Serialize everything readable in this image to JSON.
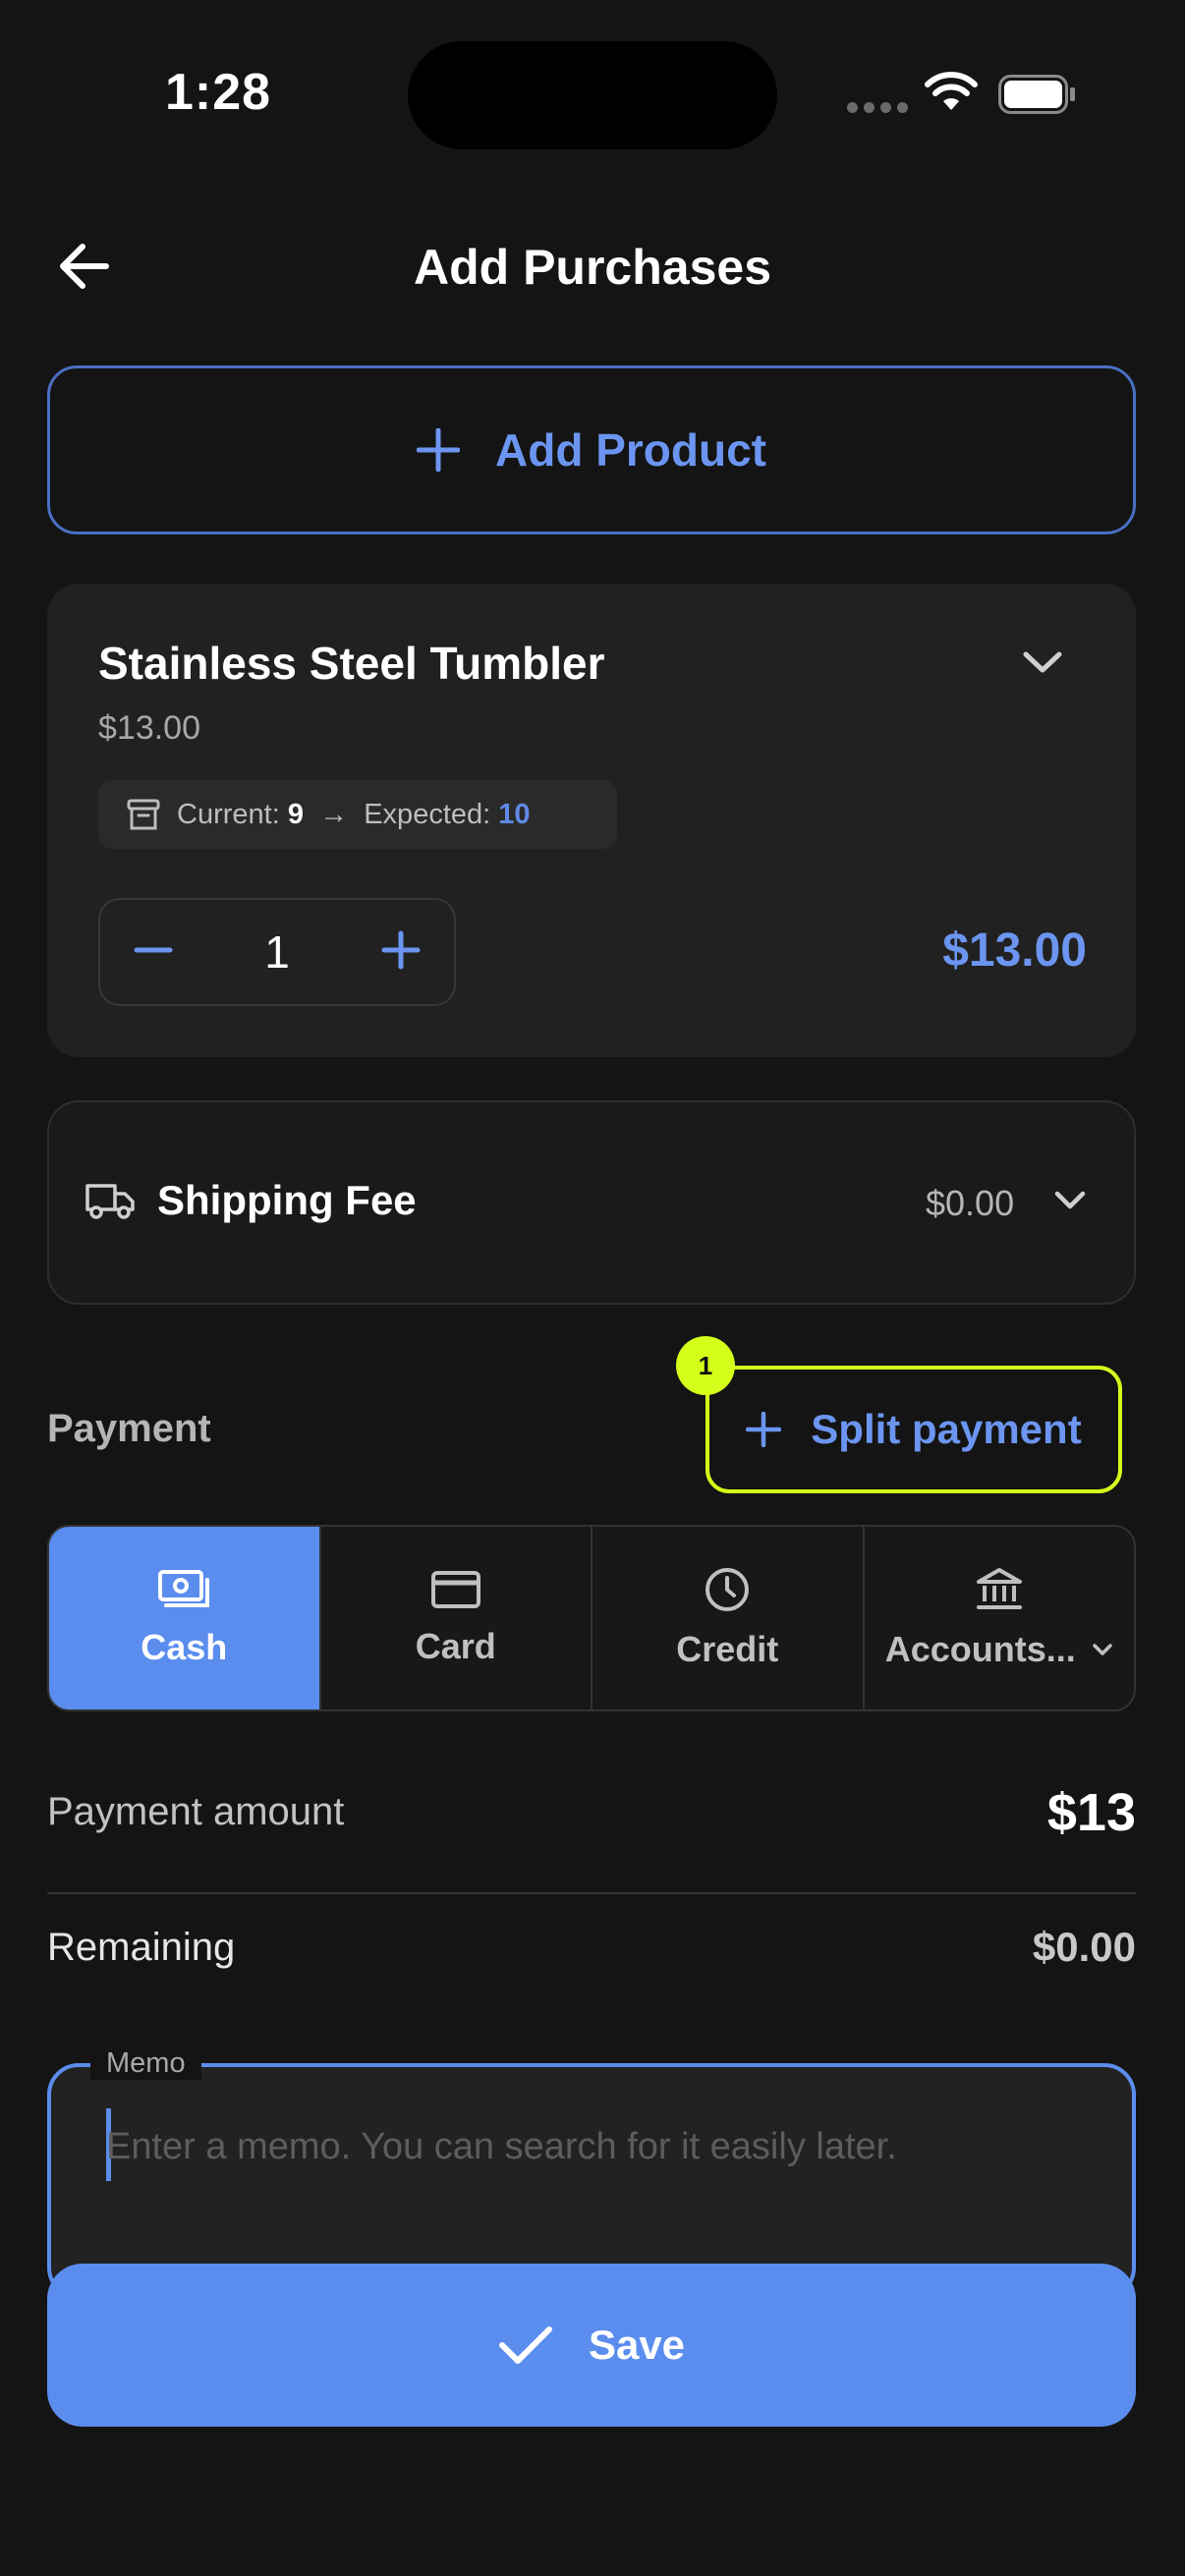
{
  "status_bar": {
    "time": "1:28"
  },
  "header": {
    "title": "Add Purchases"
  },
  "add_product": {
    "label": "Add Product"
  },
  "product": {
    "name": "Stainless Steel Tumbler",
    "price": "$13.00",
    "stock": {
      "current_label": "Current:",
      "current_value": "9",
      "arrow": "→",
      "expected_label": "Expected:",
      "expected_value": "10"
    },
    "quantity": "1",
    "line_total": "$13.00"
  },
  "shipping": {
    "label": "Shipping Fee",
    "value": "$0.00"
  },
  "payment": {
    "section_label": "Payment",
    "split_label": "Split payment",
    "badge": "1",
    "methods": [
      {
        "label": "Cash",
        "icon": "cash-icon",
        "active": true
      },
      {
        "label": "Card",
        "icon": "card-icon",
        "active": false
      },
      {
        "label": "Credit",
        "icon": "clock-icon",
        "active": false
      },
      {
        "label": "Accounts...",
        "icon": "bank-icon",
        "active": false
      }
    ],
    "amount_label": "Payment amount",
    "amount_value": "$13",
    "remaining_label": "Remaining",
    "remaining_value": "$0.00"
  },
  "memo": {
    "label": "Memo",
    "placeholder": "Enter a memo. You can search for it easily later.",
    "value": ""
  },
  "save": {
    "label": "Save"
  },
  "colors": {
    "accent": "#5b8dee",
    "accent_text": "#6b95f0",
    "highlight": "#d4ff1a",
    "background": "#141414",
    "card": "#212121"
  }
}
